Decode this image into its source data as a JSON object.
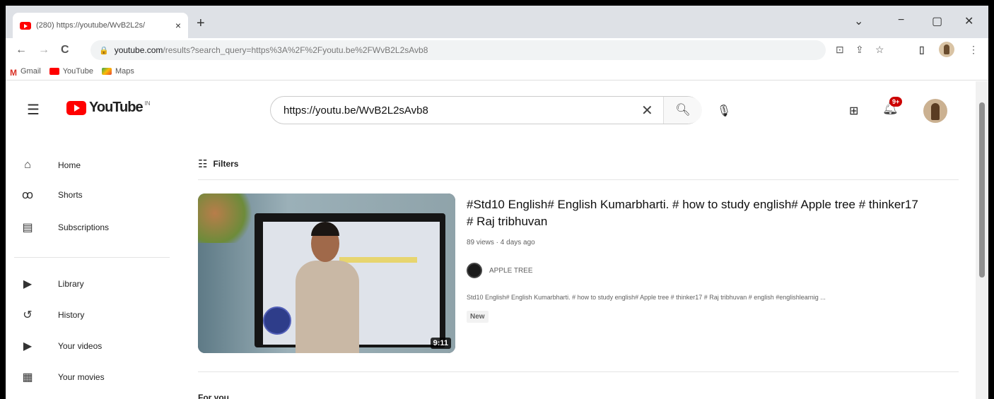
{
  "browser": {
    "tab_title": "(280) https://youtube/WvB2L2s/",
    "tab_close": "×",
    "new_tab": "+",
    "window_controls": [
      "⌄",
      "−",
      "▢",
      "✕"
    ],
    "nav": {
      "back": "←",
      "forward": "→",
      "reload": "C"
    },
    "url_host": "youtube.com",
    "url_path": "/results?search_query=https%3A%2F%2Fyoutu.be%2FWvB2L2sAvb8",
    "bookmarks": [
      "Gmail",
      "YouTube",
      "Maps"
    ]
  },
  "youtube": {
    "logo_text": "YouTube",
    "logo_country": "IN",
    "search_value": "https://youtu.be/WvB2L2sAvb8",
    "notification_count": "9+"
  },
  "sidebar": {
    "items": [
      {
        "label": "Home",
        "icon": "⌂"
      },
      {
        "label": "Shorts",
        "icon": "ꝏ"
      },
      {
        "label": "Subscriptions",
        "icon": "▤"
      },
      {
        "label": "Library",
        "icon": "▶"
      },
      {
        "label": "History",
        "icon": "↺"
      },
      {
        "label": "Your videos",
        "icon": "▶"
      },
      {
        "label": "Your movies",
        "icon": "▦"
      }
    ]
  },
  "results": {
    "filters_label": "Filters",
    "video": {
      "title": "#Std10 English# English Kumarbharti. # how to study english# Apple tree # thinker17 # Raj tribhuvan",
      "meta": "89 views · 4 days ago",
      "channel": "APPLE TREE",
      "description": "Std10 English# English Kumarbharti. # how to study english# Apple tree # thinker17 # Raj tribhuvan # english #englishlearnig ...",
      "badge": "New",
      "duration": "9:11"
    },
    "next_section": "For you"
  }
}
